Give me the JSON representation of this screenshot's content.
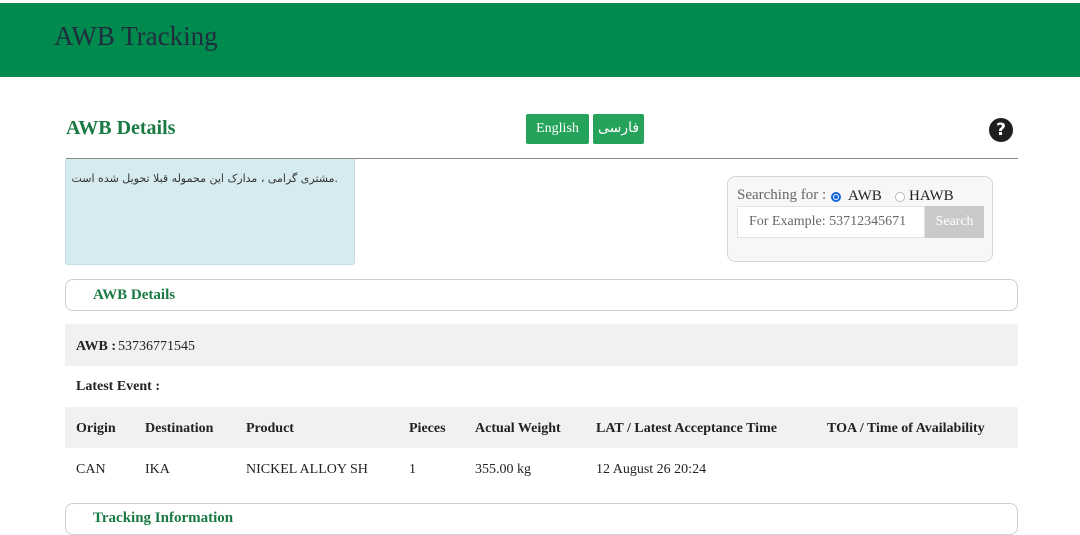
{
  "header": {
    "title": "AWB Tracking"
  },
  "page": {
    "title": "AWB Details"
  },
  "language": {
    "english_label": "English",
    "farsi_label": "فارسی"
  },
  "notice": {
    "text": ".مشتری گرامی ، مدارک این محموله قبلا تحویل شده است"
  },
  "search": {
    "label": "Searching for :",
    "options": [
      "AWB",
      "HAWB"
    ],
    "selected": "AWB",
    "placeholder": "For Example: 53712345671",
    "value": "",
    "button_label": "Search"
  },
  "details_panel": {
    "title": "AWB Details"
  },
  "awb": {
    "label": "AWB :",
    "number": "53736771545"
  },
  "latest_event": {
    "label": "Latest Event :"
  },
  "table": {
    "columns": [
      "Origin",
      "Destination",
      "Product",
      "Pieces",
      "Actual Weight",
      "LAT / Latest Acceptance Time",
      "TOA / Time of Availability"
    ],
    "rows": [
      [
        "CAN",
        "IKA",
        "NICKEL ALLOY SH",
        "1",
        "355.00 kg",
        "12 August 26 20:24",
        ""
      ]
    ]
  },
  "tracking_panel": {
    "title": "Tracking Information"
  },
  "colors": {
    "header_bg": "#008a4e",
    "accent_green": "#25a35a",
    "title_green": "#1a7a44",
    "notice_bg": "#d5ebf0"
  },
  "icons": {
    "help": "question-circle-icon"
  }
}
